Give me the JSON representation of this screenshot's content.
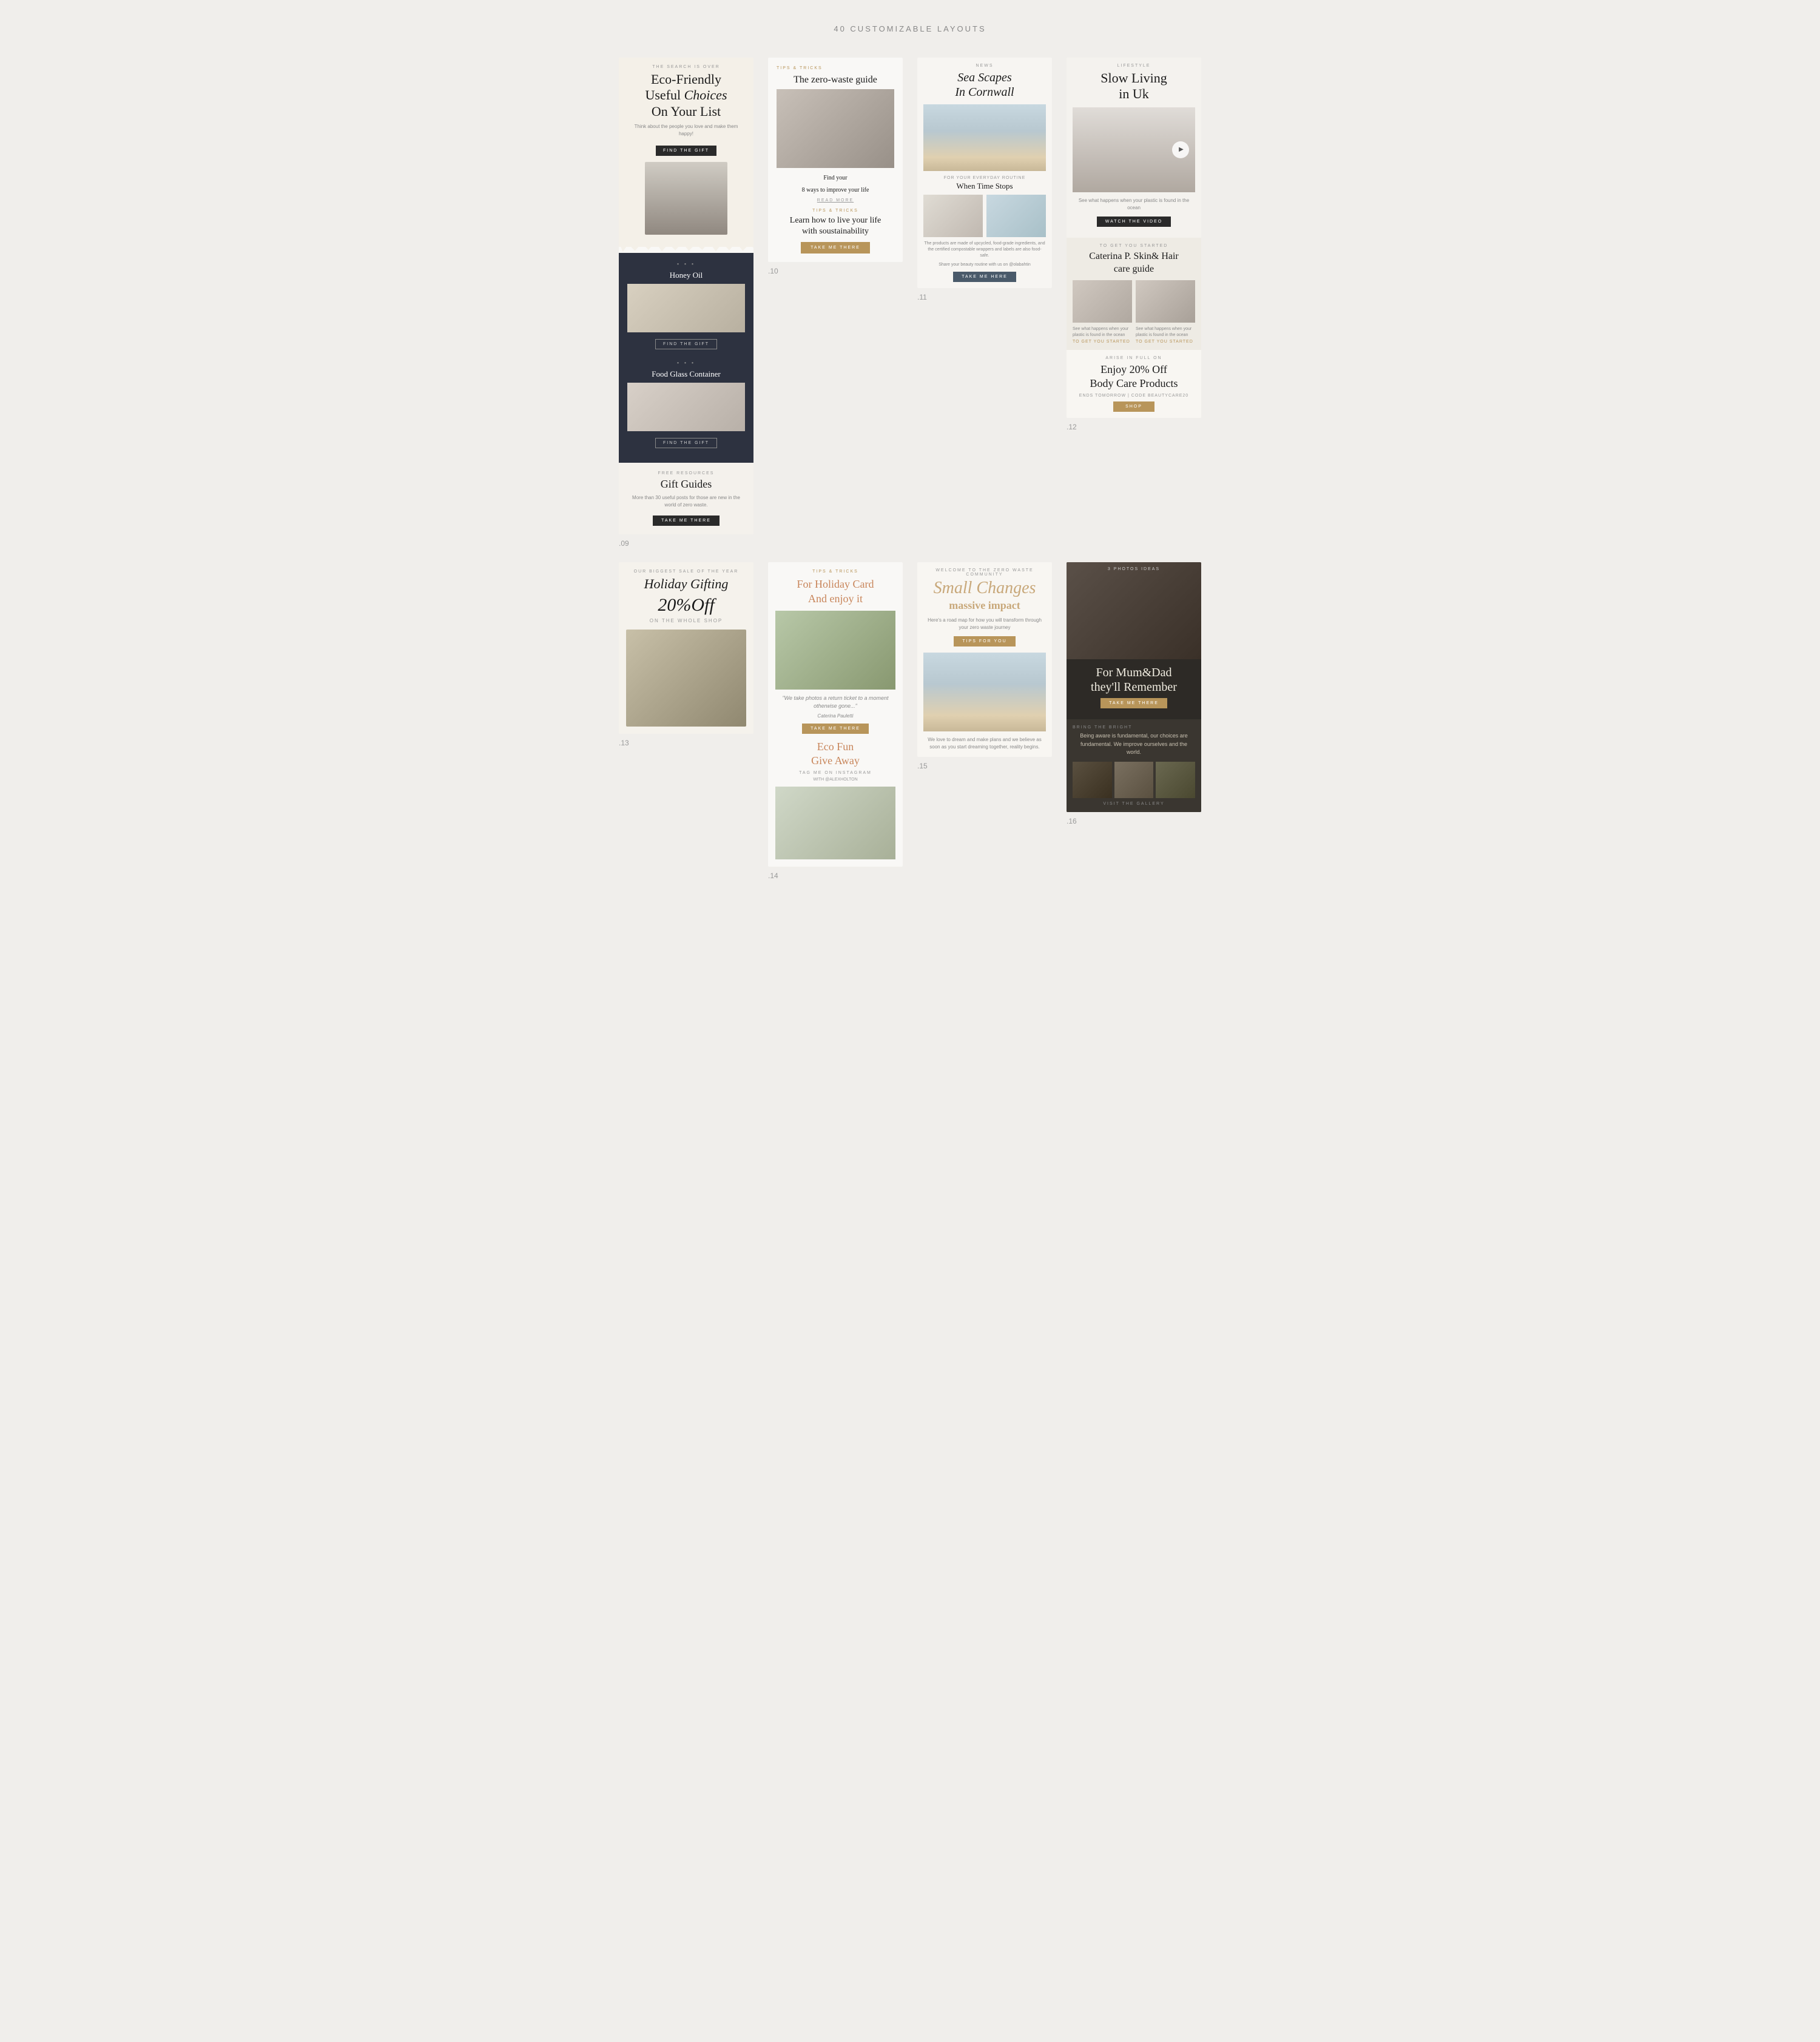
{
  "page": {
    "title": "40 CUSTOMIZABLE LAYOUTS"
  },
  "cards": {
    "c09": {
      "number": ".09",
      "label_search": "THE SEARCH IS OVER",
      "title_line1": "Eco-Friendly",
      "title_line2": "Useful ",
      "title_italic": "Choices",
      "title_line3": "On Your List",
      "subtitle": "Think about the people you love and make them happy!",
      "btn1": "FIND THE GIFT",
      "dots": "• • •",
      "item1_title": "Honey Oil",
      "btn2": "FIND THE GIFT",
      "dots2": "• • •",
      "item2_title": "Food Glass Container",
      "btn3": "FIND THE GIFT",
      "free_label": "FREE RESOURCES",
      "free_title": "Gift Guides",
      "free_desc": "More than 30 useful posts for those are new in the world of zero waste.",
      "btn4": "TAKE ME THERE"
    },
    "c10": {
      "number": ".10",
      "tag1": "TIPS & TRICKS",
      "title1": "The zero-waste guide",
      "subtitle1_line1": "Find your",
      "subtitle1_line2": "8 ways to improve your life",
      "read_more": "READ MORE",
      "tag2": "TIPS & TRICKS",
      "title2_line1": "Learn how to live your life",
      "title2_line2": "with soustainability",
      "btn": "TAKE ME THERE"
    },
    "c11": {
      "number": ".11",
      "tag": "NEWS",
      "title_line1": "Sea Scapes",
      "title_line2": "In Cornwall",
      "for_label": "FOR YOUR EVERYDAY ROUTINE",
      "when_title": "When Time Stops",
      "small_text1": "The products are made of upcycled, food-grade ingredients, and the certified compostable wrappers and labels are also food-safe.",
      "small_text2": "Share your beauty routine with us on @olabahtin",
      "btn": "TAKE ME HERE"
    },
    "c12": {
      "number": ".12",
      "lifestyle_tag": "LIFESTYLE",
      "title_line1": "Slow Living",
      "title_line2": "in Uk",
      "desc": "See what happens when your plastic is found in the ocean",
      "watch_btn": "WATCH THE VIDEO",
      "started_tag": "TO GET YOU STARTED",
      "started_title_line1": "Caterina P. Skin& Hair",
      "started_title_line2": "care guide",
      "started_desc1": "See what happens when your plastic is found in the ocean",
      "started_link1": "TO GET YOU STARTED",
      "started_desc2": "See what happens when your plastic is found in the ocean",
      "started_link2": "TO GET YOU STARTED",
      "promo_tag": "ARISE IN FULL ON",
      "promo_title_line1": "Enjoy 20% Off",
      "promo_title_line2": "Body Care Products",
      "promo_code": "ENDS TOMORROW | CODE BEAUTYCARE20",
      "shop_btn": "SHOP"
    },
    "c13": {
      "number": ".13",
      "tag": "OUR BIGGEST SALE OF THE YEAR",
      "title": "Holiday Gifting",
      "pct": "20%Off",
      "on_label": "ON THE WHOLE SHOP"
    },
    "c14": {
      "number": ".14",
      "tag1": "TIPS & TRICKS",
      "title1_line1": "For Holiday Card",
      "title1_line2": "And enjoy it",
      "quote": "\"We take photos a return ticket to a moment otherwise gone...\"",
      "author": "Caterina Pauletti",
      "btn1": "TAKE ME THERE",
      "eco_title_line1": "Eco Fun",
      "eco_title_line2": "Give Away",
      "tag2": "TAG ME ON INSTAGRAM",
      "tag2b": "WITH @ALEXHOLTON",
      "img_alt": "wedding party photo"
    },
    "c15": {
      "number": ".15",
      "tag": "WELCOME TO THE ZERO WASTE COMMUNITY",
      "script_title": "Small Changes",
      "subtitle": "massive impact",
      "desc": "Here's a road map for how you will transform through your zero waste journey",
      "btn": "TIPS FOR YOU",
      "quote": "We love to dream and make plans and we believe as soon as you start dreaming together, reality begins."
    },
    "c16": {
      "number": ".16",
      "photos_tag": "3 PHOTOS IDEAS",
      "title_line1": "For Mum&Dad",
      "title_line2": "they'll Remember",
      "btn": "TAKE ME THERE",
      "bright_tag": "BRING THE BRIGHT",
      "desc": "Being aware is fundamental, our choices are fundamental. We improve ourselves and the world.",
      "visit_tag": "VISIT THE GALLERY"
    }
  }
}
